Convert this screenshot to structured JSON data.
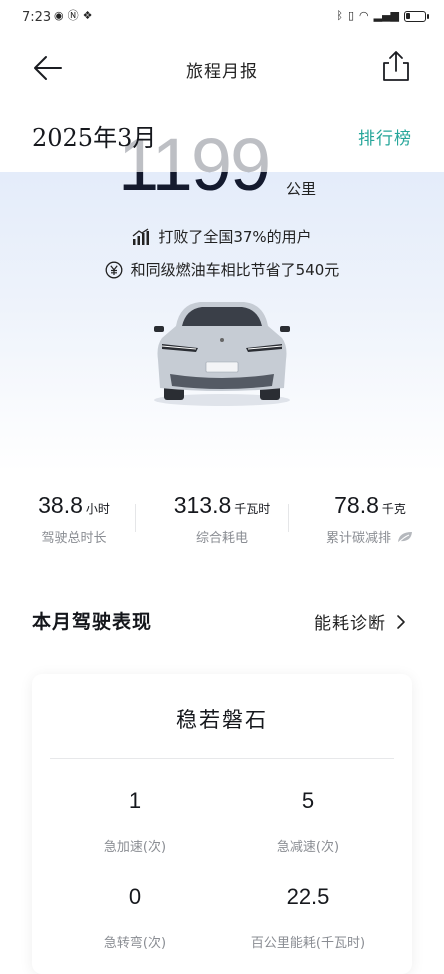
{
  "status_bar": {
    "time": "7:23",
    "left_icons": [
      "eye-icon",
      "nfc-icon",
      "app-icon"
    ],
    "right_icons": [
      "bluetooth-icon",
      "vibrate-icon",
      "wifi-icon",
      "signal-icon"
    ],
    "battery_level": 0.25
  },
  "header": {
    "title": "旅程月报"
  },
  "report": {
    "month": "2025年3月",
    "ranking_link": "排行榜",
    "distance_value": "1199",
    "distance_unit": "公里",
    "rank_text": "打败了全国37%的用户",
    "savings_text": "和同级燃油车相比节省了540元"
  },
  "metrics": [
    {
      "value": "38.8",
      "unit": "小时",
      "label": "驾驶总时长"
    },
    {
      "value": "313.8",
      "unit": "千瓦时",
      "label": "综合耗电"
    },
    {
      "value": "78.8",
      "unit": "千克",
      "label": "累计碳减排"
    }
  ],
  "performance": {
    "section_title": "本月驾驶表现",
    "diagnosis_link": "能耗诊断",
    "card_title": "稳若磐石",
    "stats": [
      {
        "value": "1",
        "label": "急加速(次)"
      },
      {
        "value": "5",
        "label": "急减速(次)"
      },
      {
        "value": "0",
        "label": "急转弯(次)"
      },
      {
        "value": "22.5",
        "label": "百公里能耗(千瓦时)"
      }
    ]
  },
  "colors": {
    "accent": "#26a69a",
    "text": "#16181d",
    "muted": "#8a8d93",
    "hero_gradient_top": "#e4ecfa"
  }
}
